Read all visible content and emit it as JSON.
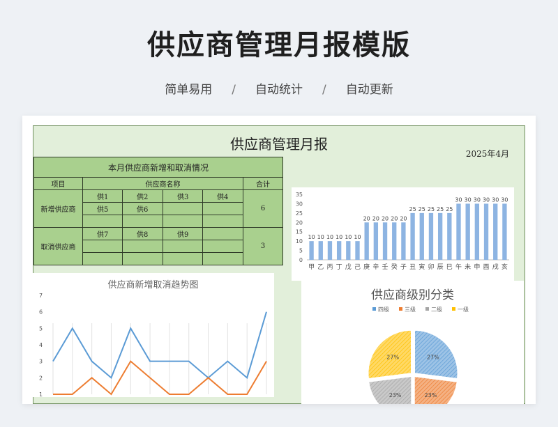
{
  "header": {
    "title": "供应商管理月报模版",
    "taglines": [
      "简单易用",
      "自动统计",
      "自动更新"
    ],
    "separator": "/"
  },
  "report": {
    "title": "供应商管理月报",
    "date": "2025年4月",
    "table": {
      "caption": "本月供应商新增和取消情况",
      "col_item": "项目",
      "col_names": "供应商名称",
      "col_total": "合计",
      "new_label": "新增供应商",
      "new_names": [
        [
          "供1",
          "供2",
          "供3",
          "供4"
        ],
        [
          "供5",
          "供6",
          "",
          ""
        ],
        [
          "",
          "",
          "",
          ""
        ]
      ],
      "new_total": "6",
      "cancel_label": "取消供应商",
      "cancel_names": [
        [
          "供7",
          "供8",
          "供9",
          ""
        ],
        [
          "",
          "",
          "",
          ""
        ],
        [
          "",
          "",
          "",
          ""
        ]
      ],
      "cancel_total": "3"
    }
  },
  "chart_data": [
    {
      "type": "bar",
      "title": "",
      "categories": [
        "甲",
        "乙",
        "丙",
        "丁",
        "戊",
        "己",
        "庚",
        "辛",
        "壬",
        "癸",
        "子",
        "丑",
        "寅",
        "卯",
        "辰",
        "巳",
        "午",
        "未",
        "申",
        "酉",
        "戌",
        "亥"
      ],
      "values": [
        10,
        10,
        10,
        10,
        10,
        10,
        20,
        20,
        20,
        20,
        20,
        25,
        25,
        25,
        25,
        25,
        30,
        30,
        30,
        30,
        30,
        30
      ],
      "ylim": [
        0,
        35
      ],
      "yticks": [
        0,
        5,
        10,
        15,
        20,
        25,
        30,
        35
      ],
      "color": "#8db4e2",
      "data_labels": true
    },
    {
      "type": "line",
      "title": "供应商新增取消趋势图",
      "yticks": [
        "1",
        "2",
        "3",
        "4",
        "5",
        "6",
        "7"
      ],
      "ylim": [
        1,
        7
      ],
      "series": [
        {
          "color": "#5b9bd5",
          "values": [
            3,
            5,
            3,
            2,
            5,
            3,
            3,
            3,
            2,
            3,
            2,
            6
          ]
        },
        {
          "color": "#ed7d31",
          "values": [
            1,
            1,
            2,
            1,
            3,
            2,
            1,
            1,
            2,
            1,
            1,
            3
          ]
        }
      ],
      "grid": "vertical"
    },
    {
      "type": "pie",
      "title": "供应商级别分类",
      "legend": [
        "四级",
        "三级",
        "二级",
        "一级"
      ],
      "legend_position": "top",
      "values": [
        27,
        23,
        23,
        27
      ],
      "labels": [
        "27%",
        "23%",
        "23%",
        "27%"
      ],
      "colors": [
        "#9dc3e6",
        "#f4b183",
        "#c9c9c9",
        "#ffd966"
      ],
      "stroke_colors": [
        "#5b9bd5",
        "#ed7d31",
        "#a5a5a5",
        "#ffc000"
      ]
    }
  ]
}
